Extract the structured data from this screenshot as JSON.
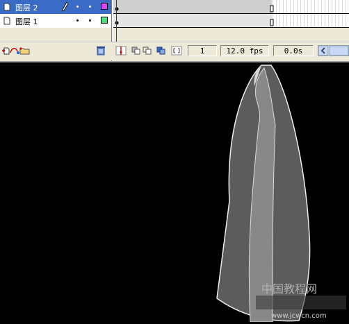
{
  "layers": [
    {
      "name": "图层 2",
      "selected": true,
      "swatch": "#d946ef"
    },
    {
      "name": "图层 1",
      "selected": false,
      "swatch": "#4ade80"
    }
  ],
  "controls": {
    "current_frame": "1",
    "frame_rate": "12.0 fps",
    "elapsed_time": "0.0s"
  },
  "watermark": {
    "title": "中国教程网",
    "url": "www.jcwcn.com"
  },
  "colors": {
    "selection": "#3a6bc6",
    "panel": "#ece9d8",
    "stage": "#000000",
    "playhead": "#cc0000"
  }
}
